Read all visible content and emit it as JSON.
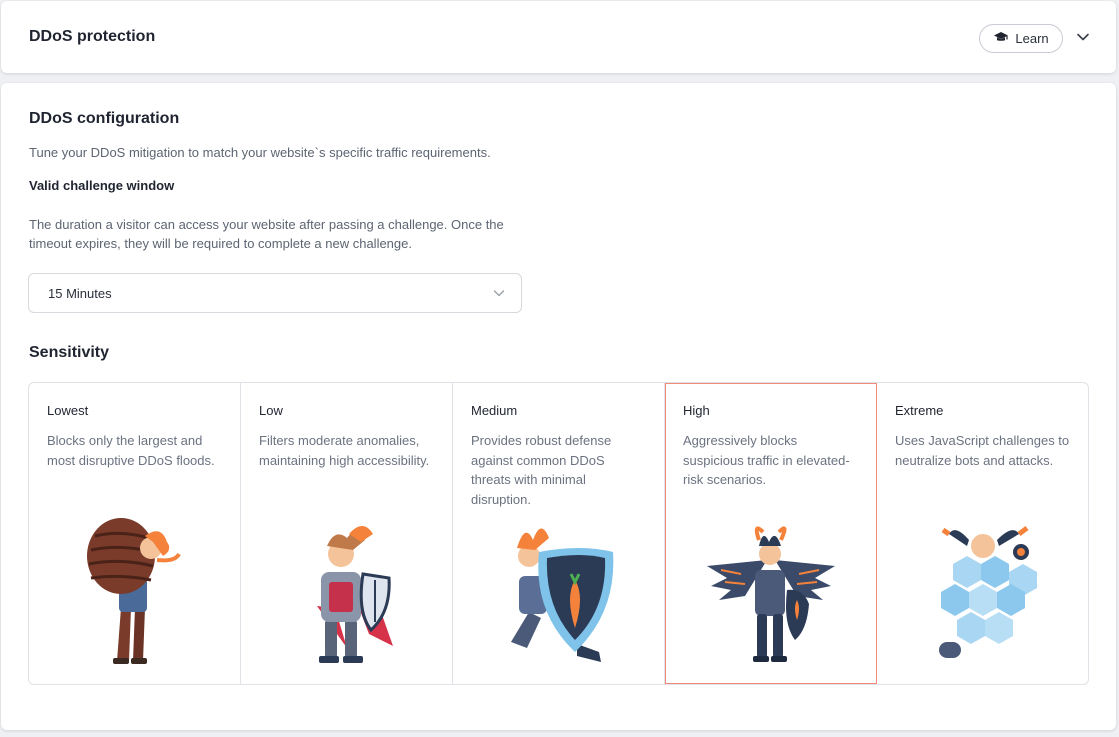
{
  "header": {
    "title": "DDoS protection",
    "learn_label": "Learn"
  },
  "config": {
    "title": "DDoS configuration",
    "description": "Tune your DDoS mitigation to match your website`s specific traffic requirements.",
    "window_label": "Valid challenge window",
    "window_description_1": "The duration a visitor can access your website after passing a challenge. Once the",
    "window_description_2": "timeout expires, they will be required to complete a new challenge.",
    "window_value": "15 Minutes"
  },
  "sensitivity": {
    "title": "Sensitivity",
    "selected": "High",
    "levels": [
      {
        "name": "Lowest",
        "description": "Blocks only the largest and most disruptive DDoS floods.",
        "illustration": "shield-bearer-wooden-shield-icon"
      },
      {
        "name": "Low",
        "description": "Filters moderate anomalies, maintaining high accessibility.",
        "illustration": "armored-knight-shield-icon"
      },
      {
        "name": "Medium",
        "description": "Provides robust defense against common DDoS threats with minimal disruption.",
        "illustration": "kneeling-warrior-carrot-shield-icon"
      },
      {
        "name": "High",
        "description": "Aggressively blocks suspicious traffic in elevated-risk scenarios.",
        "illustration": "winged-armored-warrior-icon"
      },
      {
        "name": "Extreme",
        "description": "Uses JavaScript challenges to neutralize bots and attacks.",
        "illustration": "hexagon-shielded-robot-icon"
      }
    ]
  },
  "colors": {
    "accent_selected": "#f28a78",
    "orange": "#f5823a",
    "navy": "#2b3a55"
  }
}
